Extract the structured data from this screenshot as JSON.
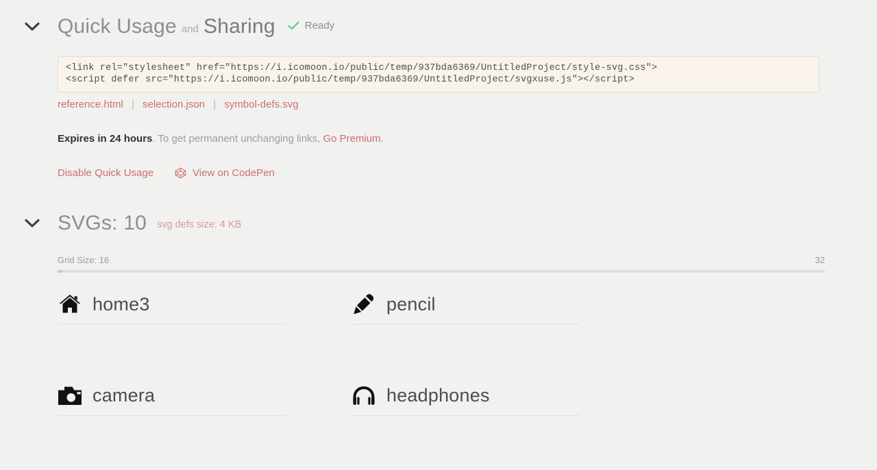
{
  "quick_usage": {
    "chevron_icon": "chevron-down-icon",
    "title_part1": "Quick Usage",
    "conjunction": "and",
    "title_part2": "Sharing",
    "status_icon": "check-icon",
    "status_label": "Ready",
    "status_color": "#5bc873",
    "code_snippet": "<link rel=\"stylesheet\" href=\"https://i.icomoon.io/public/temp/937bda6369/UntitledProject/style-svg.css\">\n<script defer src=\"https://i.icomoon.io/public/temp/937bda6369/UntitledProject/svgxuse.js\"></script>",
    "file_links": [
      {
        "label": "reference.html"
      },
      {
        "label": "selection.json"
      },
      {
        "label": "symbol-defs.svg"
      }
    ],
    "link_separator": "|",
    "expiry_strong": "Expires in 24 hours",
    "expiry_text": ". To get permanent unchanging links, ",
    "premium_link": "Go Premium",
    "expiry_end": ".",
    "disable_label": "Disable Quick Usage",
    "codepen_icon": "codepen-icon",
    "codepen_label": "View on CodePen",
    "link_color": "#cd7069"
  },
  "svgs": {
    "chevron_icon": "chevron-down-icon",
    "title": "SVGs: 10",
    "defs_size": "svg defs size: 4 KB",
    "defs_size_color": "#d99a9a",
    "grid_size_label": "Grid Size: 16",
    "grid_size_value": 16,
    "grid_size_max_label": "32",
    "grid_size_max": 32,
    "icons": [
      {
        "name": "home3",
        "icon": "home-icon"
      },
      {
        "name": "pencil",
        "icon": "pencil-icon"
      },
      {
        "name": "camera",
        "icon": "camera-icon"
      },
      {
        "name": "headphones",
        "icon": "headphones-icon"
      }
    ]
  },
  "theme": {
    "page_background": "#f1f1f0",
    "code_background": "#faf3ec",
    "code_border": "#e0dcd6",
    "heading_color": "#8e8e8e",
    "icon_name_color": "#4d4d4d"
  }
}
